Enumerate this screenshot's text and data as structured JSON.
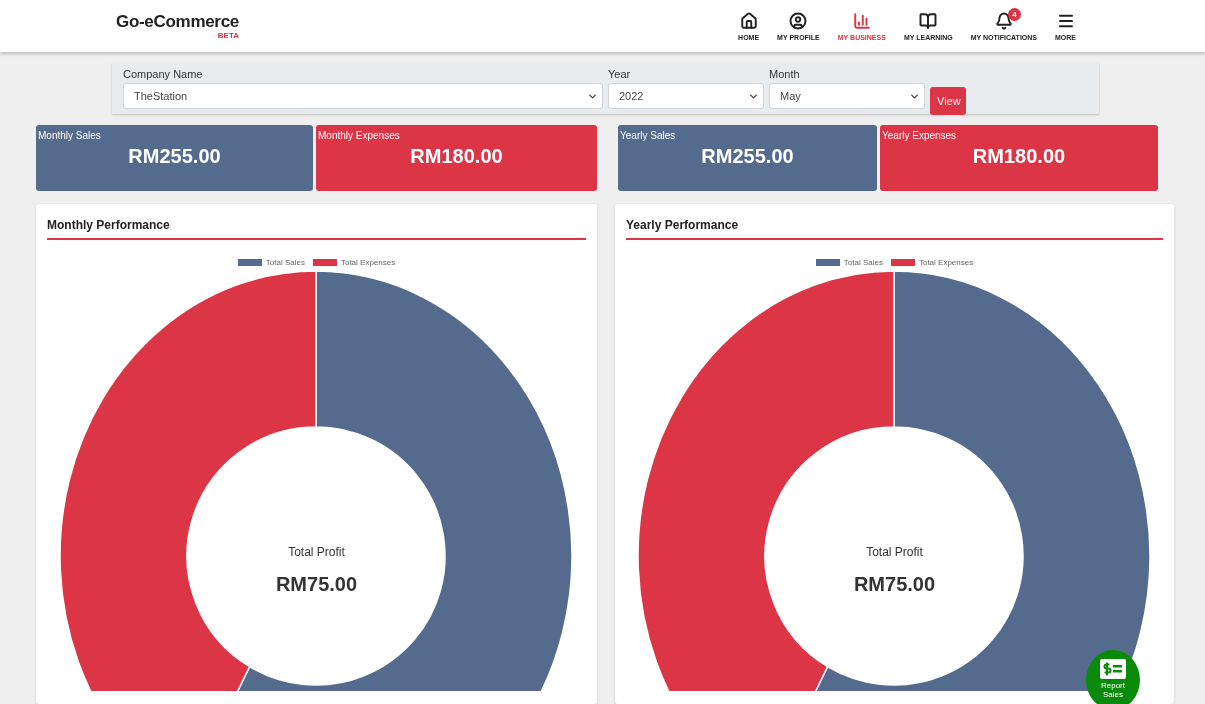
{
  "header": {
    "logo": "Go-eCommerce",
    "badge": "BETA",
    "nav": [
      {
        "label": "HOME",
        "selected": false
      },
      {
        "label": "MY PROFILE",
        "selected": false
      },
      {
        "label": "MY BUSINESS",
        "selected": true
      },
      {
        "label": "MY LEARNING",
        "selected": false
      },
      {
        "label": "MY NOTIFICATIONS",
        "selected": false,
        "count": "4"
      },
      {
        "label": "MORE",
        "selected": false
      }
    ]
  },
  "filters": {
    "fields": [
      {
        "label": "Company Name",
        "value": "TheStation"
      },
      {
        "label": "Year",
        "value": "2022"
      },
      {
        "label": "Month",
        "value": "May"
      }
    ],
    "button": "View"
  },
  "stats": [
    {
      "kind": "sales",
      "label": "Monthly Sales",
      "value": "RM255.00"
    },
    {
      "kind": "expenses",
      "label": "Monthly Expenses",
      "value": "RM180.00"
    },
    {
      "kind": "sales",
      "label": "Yearly Sales",
      "value": "RM255.00"
    },
    {
      "kind": "expenses",
      "label": "Yearly Expenses",
      "value": "RM180.00"
    }
  ],
  "panels": [
    {
      "title": "Monthly Performance",
      "center_label": "Total Profit",
      "center_value": "RM75.00",
      "chart_data": {
        "type": "donut",
        "categories": [
          "Total Sales",
          "Total Expenses"
        ],
        "series": [
          {
            "colors": [
              "#556b8d",
              "#dc3545"
            ],
            "values": [
              58.6,
              41.4
            ]
          }
        ]
      }
    },
    {
      "title": "Yearly Performance",
      "center_label": "Total Profit",
      "center_value": "RM75.00",
      "chart_data": {
        "type": "donut",
        "categories": [
          "Total Sales",
          "Total Expenses"
        ],
        "series": [
          {
            "colors": [
              "#556b8d",
              "#dc3545"
            ],
            "values": [
              58.6,
              41.4
            ]
          }
        ]
      }
    }
  ],
  "fab": {
    "label": "Report Sales"
  }
}
